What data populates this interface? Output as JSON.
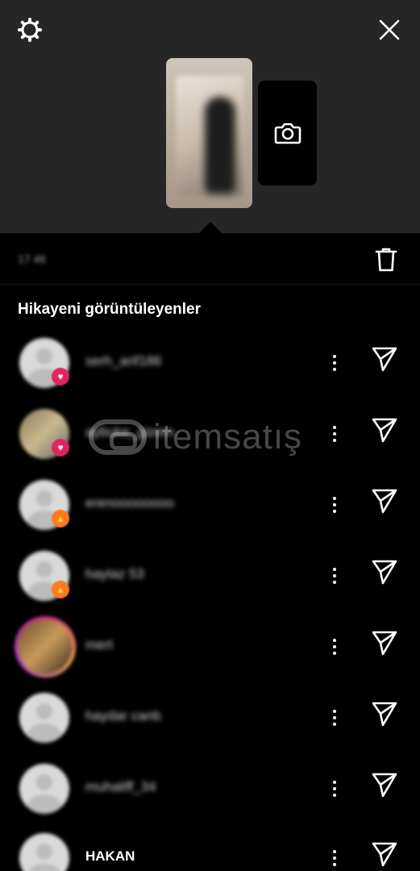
{
  "header": {
    "settings_icon": "gear-icon",
    "close_icon": "close-icon",
    "camera_icon": "camera-icon"
  },
  "stats": {
    "views_count": "17 46",
    "delete_icon": "trash-icon"
  },
  "section_title": "Hikayeni görüntüleyenler",
  "viewers": [
    {
      "username": "serh_arif186",
      "avatar": "default",
      "reaction": "heart"
    },
    {
      "username": "aybuke_gizem",
      "avatar": "photo",
      "reaction": "heart"
    },
    {
      "username": "erenoooooooo",
      "avatar": "default",
      "reaction": "fire"
    },
    {
      "username": "haylaz 53",
      "avatar": "default",
      "reaction": "fire"
    },
    {
      "username": "mert",
      "avatar": "story",
      "reaction": ""
    },
    {
      "username": "haydar canb",
      "avatar": "default",
      "reaction": ""
    },
    {
      "username": "muhaliff_34",
      "avatar": "default",
      "reaction": ""
    },
    {
      "username": "HAKAN",
      "avatar": "default",
      "reaction": ""
    }
  ],
  "watermark": "itemsatış",
  "colors": {
    "background": "#000000",
    "top_area": "#262626",
    "heart_badge": "#e0245e",
    "fire_badge": "#ff7a1a"
  }
}
